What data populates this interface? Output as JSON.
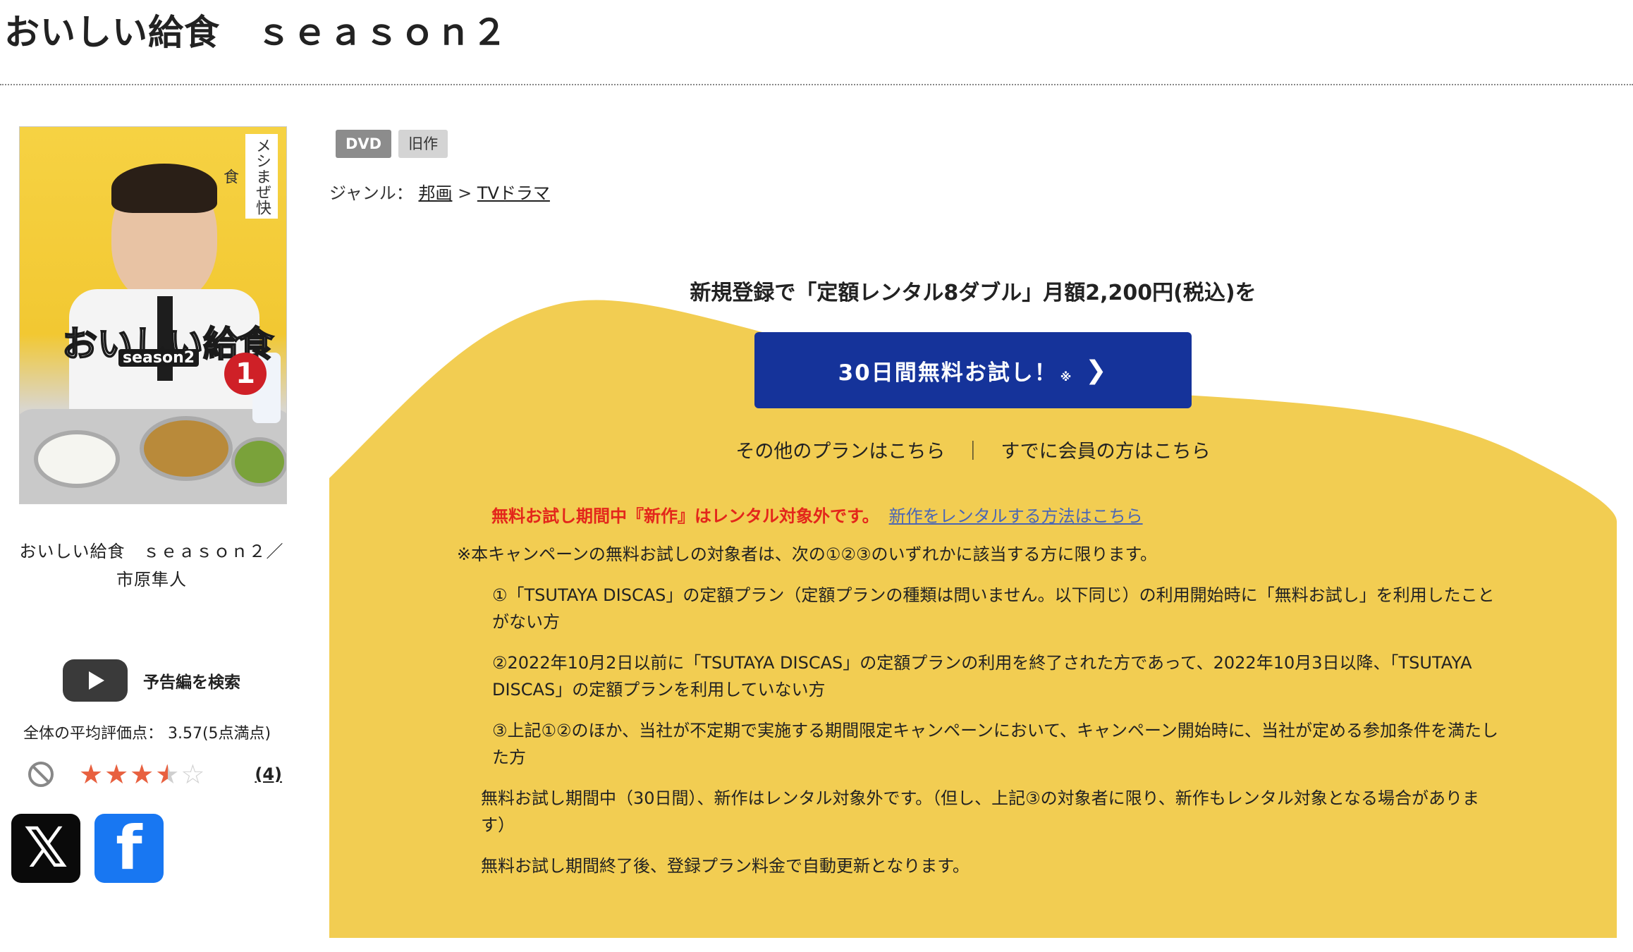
{
  "page": {
    "title": "おいしい給食　ｓｅａｓｏｎ２"
  },
  "product": {
    "cover_alt": "おいしい給食 season2 1",
    "caption": "おいしい給食　ｓｅａｓｏｎ２／市原隼人",
    "tags": [
      "DVD",
      "旧作"
    ],
    "genre_label": "ジャンル：",
    "genre_path": [
      "邦画",
      "TVドラマ"
    ],
    "genre_sep": " > "
  },
  "sidebar": {
    "trailer_label": "予告編を検索",
    "avg_rating_text": "全体の平均評価点： 3.57(5点満点)",
    "rating_value": 3.57,
    "review_count": "(4)"
  },
  "promo": {
    "headline": "新規登録で「定額レンタル8ダブル」月額2,200円(税込)を",
    "cta_label": "30日間無料お試し！",
    "cta_mark": "※",
    "other_plans": "その他のプランはこちら",
    "separator": "｜",
    "members": "すでに会員の方はこちら",
    "warning": "無料お試し期間中『新作』はレンタル対象外です。",
    "how_to_rent": "新作をレンタルする方法はこちら",
    "terms_head": "※本キャンペーンの無料お試しの対象者は、次の①②③のいずれかに該当する方に限ります。",
    "terms_items": [
      "①「TSUTAYA DISCAS」の定額プラン（定額プランの種類は問いません。以下同じ）の利用開始時に「無料お試し」を利用したことがない方",
      "②2022年10月2日以前に「TSUTAYA DISCAS」の定額プランの利用を終了された方であって、2022年10月3日以降、「TSUTAYA DISCAS」の定額プランを利用していない方",
      "③上記①②のほか、当社が不定期で実施する期間限定キャンペーンにおいて、キャンペーン開始時に、当社が定める参加条件を満たした方"
    ],
    "terms_notes": [
      "無料お試し期間中（30日間）、新作はレンタル対象外です。（但し、上記③の対象者に限り、新作もレンタル対象となる場合があります）",
      "無料お試し期間終了後、登録プラン料金で自動更新となります。"
    ]
  },
  "colors": {
    "promo_yellow": "#f2cd52",
    "cta_blue": "#15339a",
    "warning_red": "#e3261b",
    "link_blue": "#4a66b5",
    "star_orange": "#e8603f",
    "facebook_blue": "#1877f2"
  },
  "icons": {
    "trailer": "youtube-play-icon",
    "not_interested": "prohibited-icon",
    "share_x": "x-logo-icon",
    "share_facebook": "facebook-logo-icon",
    "cta_arrow": "chevron-right-icon"
  }
}
